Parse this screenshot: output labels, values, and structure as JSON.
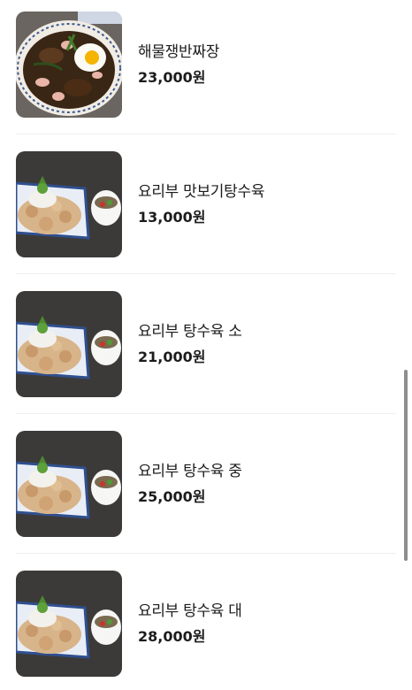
{
  "menu": {
    "items": [
      {
        "name": "해물쟁반짜장",
        "price": "23,000원",
        "image": "jjajang-plate-image"
      },
      {
        "name": "요리부 맛보기탕수육",
        "price": "13,000원",
        "image": "tangsuyuk-image"
      },
      {
        "name": "요리부 탕수육 소",
        "price": "21,000원",
        "image": "tangsuyuk-image"
      },
      {
        "name": "요리부 탕수육 중",
        "price": "25,000원",
        "image": "tangsuyuk-image"
      },
      {
        "name": "요리부 탕수육 대",
        "price": "28,000원",
        "image": "tangsuyuk-image"
      }
    ]
  },
  "colors": {
    "divider": "#efefef",
    "scrollbar": "#8e8e8e",
    "text": "#1c1c1c"
  }
}
